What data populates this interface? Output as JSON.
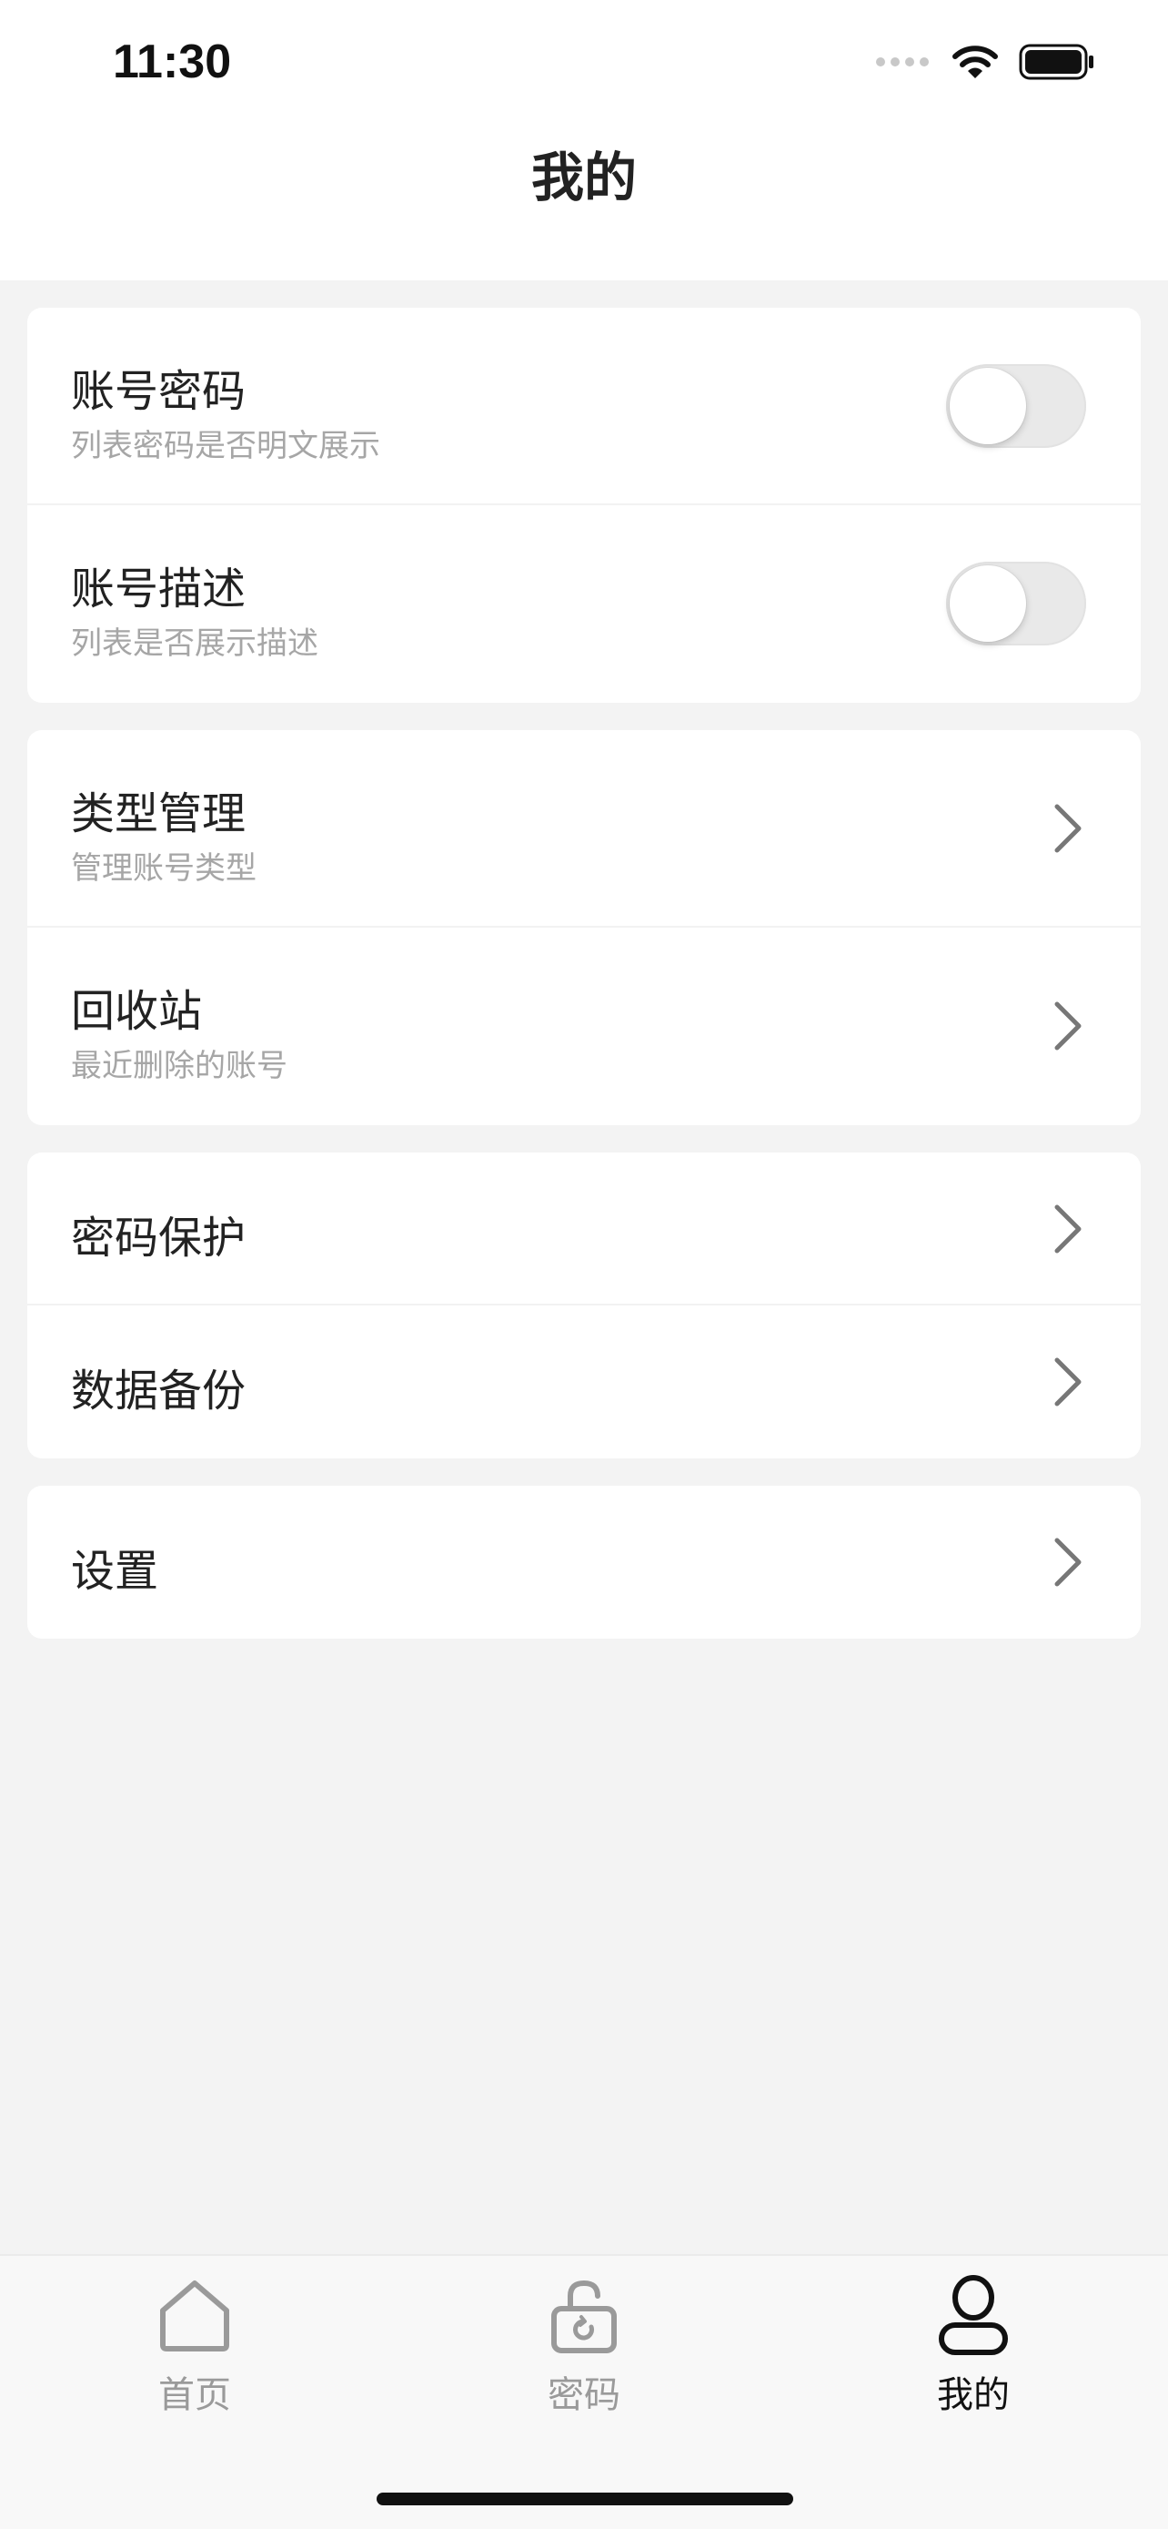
{
  "status_bar": {
    "time": "11:30",
    "icons": [
      "signal-dots-icon",
      "wifi-icon",
      "battery-icon"
    ]
  },
  "header": {
    "title": "我的"
  },
  "groups": [
    {
      "rows": [
        {
          "title": "账号密码",
          "subtitle": "列表密码是否明文展示",
          "control": "toggle",
          "on": false
        },
        {
          "title": "账号描述",
          "subtitle": "列表是否展示描述",
          "control": "toggle",
          "on": false
        }
      ]
    },
    {
      "rows": [
        {
          "title": "类型管理",
          "subtitle": "管理账号类型",
          "control": "chevron"
        },
        {
          "title": "回收站",
          "subtitle": "最近删除的账号",
          "control": "chevron"
        }
      ]
    },
    {
      "rows": [
        {
          "title": "密码保护",
          "control": "chevron"
        },
        {
          "title": "数据备份",
          "control": "chevron"
        }
      ]
    },
    {
      "rows": [
        {
          "title": "设置",
          "control": "chevron"
        }
      ]
    }
  ],
  "tabbar": {
    "tabs": [
      {
        "label": "首页",
        "icon": "home-icon",
        "active": false
      },
      {
        "label": "密码",
        "icon": "lock-icon",
        "active": false
      },
      {
        "label": "我的",
        "icon": "user-icon",
        "active": true
      }
    ],
    "active_color": "#111111",
    "inactive_color": "#9a9a9a"
  }
}
